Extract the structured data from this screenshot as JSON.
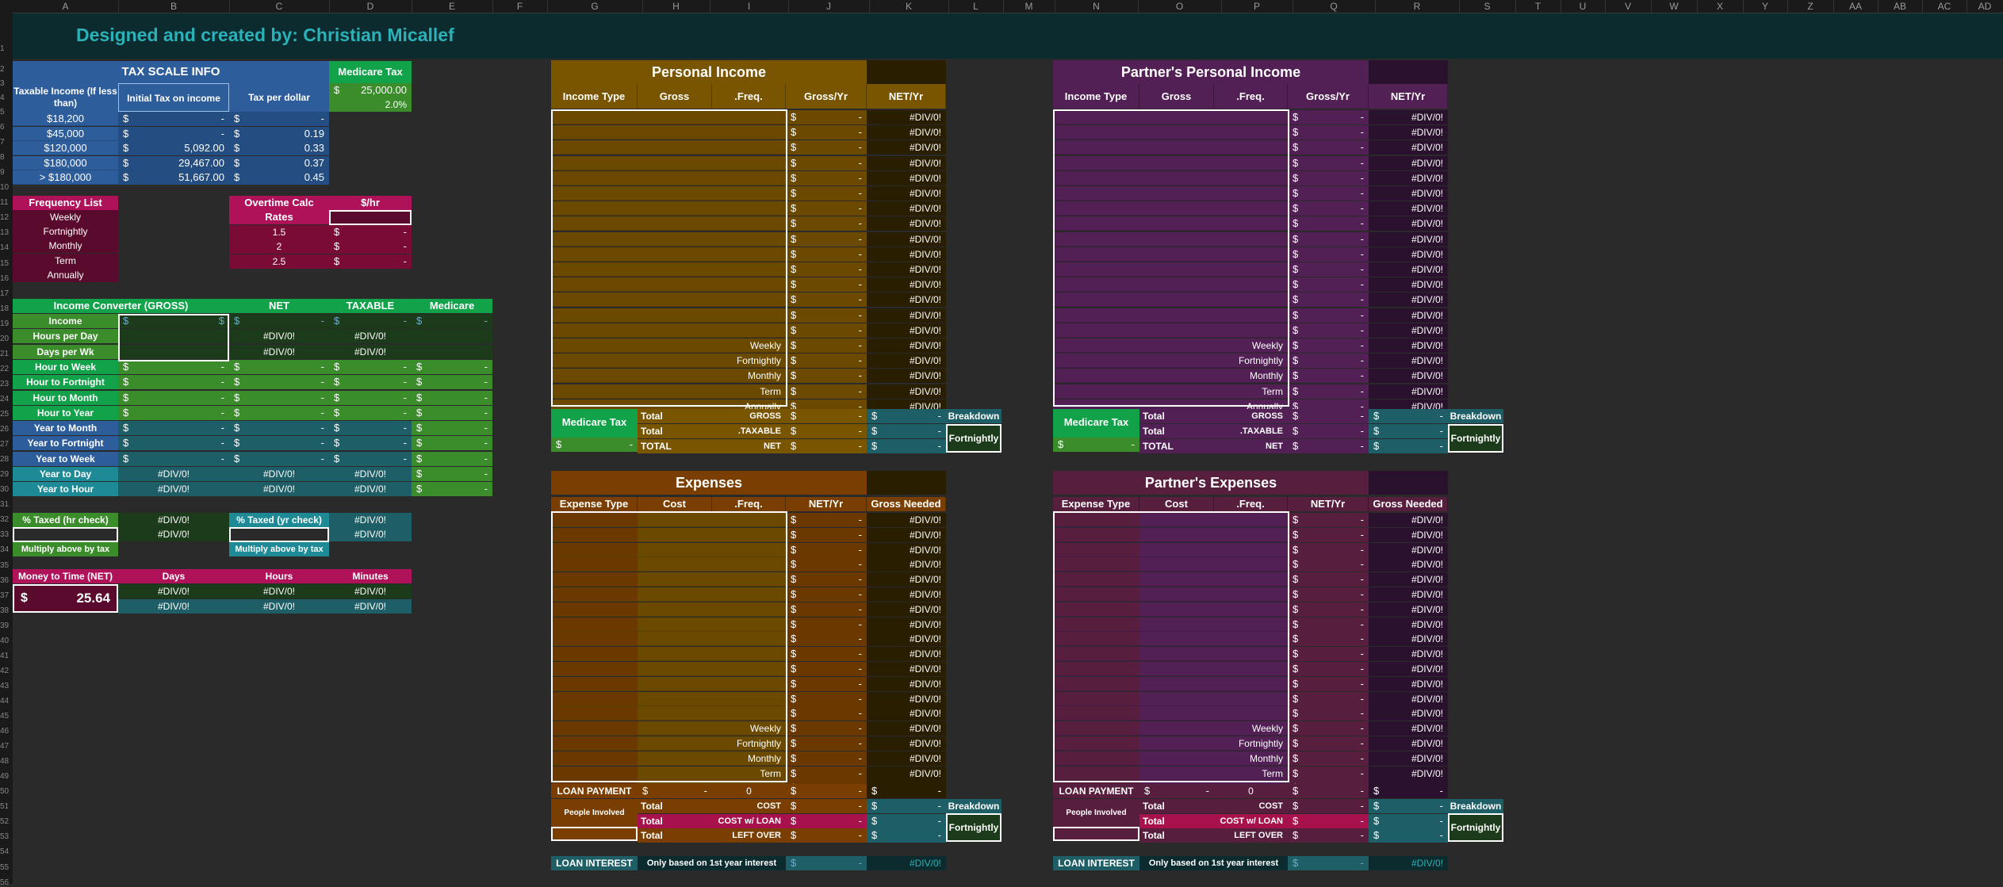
{
  "columns": [
    "A",
    "B",
    "C",
    "D",
    "E",
    "F",
    "G",
    "H",
    "I",
    "J",
    "K",
    "L",
    "M",
    "N",
    "O",
    "P",
    "Q",
    "R",
    "S",
    "T",
    "U",
    "V",
    "W",
    "X",
    "Y",
    "Z",
    "AA",
    "AB",
    "AC",
    "AD"
  ],
  "banner": {
    "title": "Designed and created by:   Christian Micallef"
  },
  "tax_scale": {
    "title": "TAX SCALE INFO",
    "headers": [
      "Taxable Income (If less than)",
      "Initial Tax on income",
      "Tax per dollar"
    ],
    "rows": [
      [
        "$18,200",
        "-",
        "-"
      ],
      [
        "$45,000",
        "-",
        "0.19"
      ],
      [
        "$120,000",
        "5,092.00",
        "0.33"
      ],
      [
        "$180,000",
        "29,467.00",
        "0.37"
      ],
      [
        "> $180,000",
        "51,667.00",
        "0.45"
      ]
    ]
  },
  "medicare_tax": {
    "title": "Medicare Tax",
    "amount": "25,000.00",
    "rate": "2.0%"
  },
  "frequency_list": {
    "title": "Frequency List",
    "items": [
      "Weekly",
      "Fortnightly",
      "Monthly",
      "Term",
      "Annually"
    ]
  },
  "overtime": {
    "title": "Overtime Calc",
    "unit": "$/hr",
    "rates_label": "Rates",
    "rates": [
      "1.5",
      "2",
      "2.5"
    ]
  },
  "converter": {
    "headers": [
      "Income Converter (GROSS)",
      "NET",
      "TAXABLE",
      "Medicare"
    ],
    "rows": [
      {
        "label": "Income",
        "b": "$",
        "c": "-",
        "d": "-",
        "e": "-"
      },
      {
        "label": "Hours per Day",
        "c": "#DIV/0!",
        "d": "#DIV/0!"
      },
      {
        "label": "Days per Wk",
        "c": "#DIV/0!",
        "d": "#DIV/0!"
      },
      {
        "label": "Hour to Week",
        "b": "-",
        "c": "-",
        "d": "-",
        "e": "-"
      },
      {
        "label": "Hour to Fortnight",
        "b": "-",
        "c": "-",
        "d": "-",
        "e": "-"
      },
      {
        "label": "Hour to Month",
        "b": "-",
        "c": "-",
        "d": "-",
        "e": "-"
      },
      {
        "label": "Hour to Year",
        "b": "-",
        "c": "-",
        "d": "-",
        "e": "-"
      },
      {
        "label": "Year to Month",
        "b": "-",
        "c": "-",
        "d": "-",
        "e": "-"
      },
      {
        "label": "Year to Fortnight",
        "b": "-",
        "c": "-",
        "d": "-",
        "e": "-"
      },
      {
        "label": "Year to Week",
        "b": "-",
        "c": "-",
        "d": "-",
        "e": "-"
      },
      {
        "label": "Year to Day",
        "b": "#DIV/0!",
        "c": "#DIV/0!",
        "d": "#DIV/0!",
        "e": "-"
      },
      {
        "label": "Year to Hour",
        "b": "#DIV/0!",
        "c": "#DIV/0!",
        "d": "#DIV/0!",
        "e": "-"
      }
    ]
  },
  "taxed": {
    "hr_label": "% Taxed (hr check)",
    "yr_label": "% Taxed (yr check)",
    "div": "#DIV/0!",
    "multiply_note": "Multiply above by tax"
  },
  "money_time": {
    "title": "Money to Time (NET)",
    "headers": [
      "Days",
      "Hours",
      "Minutes"
    ],
    "value": "25.64",
    "div": "#DIV/0!"
  },
  "personal_income": {
    "title": "Personal Income",
    "headers": [
      "Income Type",
      "Gross",
      ".Freq.",
      "Gross/Yr",
      "NET/Yr"
    ],
    "summary_freqs": [
      "Weekly",
      "Fortnightly",
      "Monthly",
      "Term",
      "Annually"
    ],
    "div": "#DIV/0!",
    "dash": "-",
    "dollar": "$",
    "medicare": "Medicare Tax",
    "totals": [
      [
        "Total",
        "GROSS"
      ],
      [
        "Total",
        ".TAXABLE"
      ],
      [
        "TOTAL",
        "NET"
      ]
    ],
    "breakdown": "Breakdown",
    "breakdown_sel": "Fortnightly"
  },
  "partner_income": {
    "title": "Partner's Personal Income"
  },
  "expenses": {
    "title": "Expenses",
    "headers": [
      "Expense Type",
      "Cost",
      ".Freq.",
      "NET/Yr",
      "Gross Needed"
    ],
    "loan_payment": "LOAN PAYMENT",
    "loan_zero": "0",
    "people": "People Involved",
    "totals": [
      [
        "Total",
        "COST"
      ],
      [
        "Total",
        "COST w/ LOAN"
      ],
      [
        "Total",
        "LEFT OVER"
      ]
    ],
    "loan_interest": "LOAN INTEREST",
    "interest_note": "Only based on 1st year interest"
  },
  "partner_expenses": {
    "title": "Partner's Expenses"
  },
  "colors": {
    "income": "#7a5500",
    "partner": "#522055",
    "expenses": "#7a3f00",
    "partner_exp": "#571e3d",
    "teal": "#1e5e66",
    "green": "#12a24a",
    "blue": "#2e5d9c",
    "magenta": "#b0125a"
  }
}
